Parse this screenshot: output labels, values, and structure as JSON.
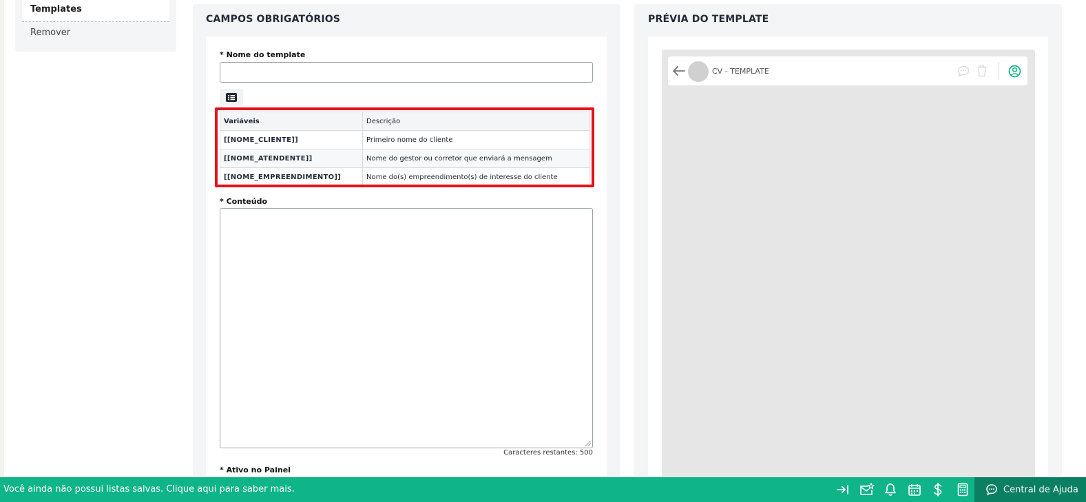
{
  "sidebar": {
    "items": [
      {
        "label": "Templates",
        "active": true
      },
      {
        "label": "Remover",
        "active": false
      }
    ]
  },
  "form": {
    "title": "CAMPOS OBRIGATÓRIOS",
    "name_label": "* Nome do template",
    "name_value": "",
    "variables_table": {
      "headers": [
        "Variáveis",
        "Descrição"
      ],
      "rows": [
        {
          "variable": "[[NOME_CLIENTE]]",
          "description": "Primeiro nome do cliente"
        },
        {
          "variable": "[[NOME_ATENDENTE]]",
          "description": "Nome do gestor ou corretor que enviará a mensagem"
        },
        {
          "variable": "[[NOME_EMPREENDIMENTO]]",
          "description": "Nome do(s) empreendimento(s) de interesse do cliente"
        }
      ]
    },
    "content_label": "* Conteúdo",
    "content_value": "",
    "chars_remaining": "Caracteres restantes: 500",
    "active_label": "* Ativo no Painel"
  },
  "preview": {
    "title": "PRÉVIA DO TEMPLATE",
    "chat_title": "CV - TEMPLATE"
  },
  "bottom_bar": {
    "message": "Você ainda não possui listas salvas. Clique aqui para saber mais.",
    "help_label": "Central de Ajuda",
    "icons": [
      "collapse-icon",
      "mail-star-icon",
      "bell-icon",
      "calendar-icon",
      "dollar-icon",
      "calculator-icon"
    ]
  },
  "colors": {
    "accent_green": "#0fb488",
    "help_green": "#0b7f62",
    "highlight_red": "#e8101a"
  }
}
